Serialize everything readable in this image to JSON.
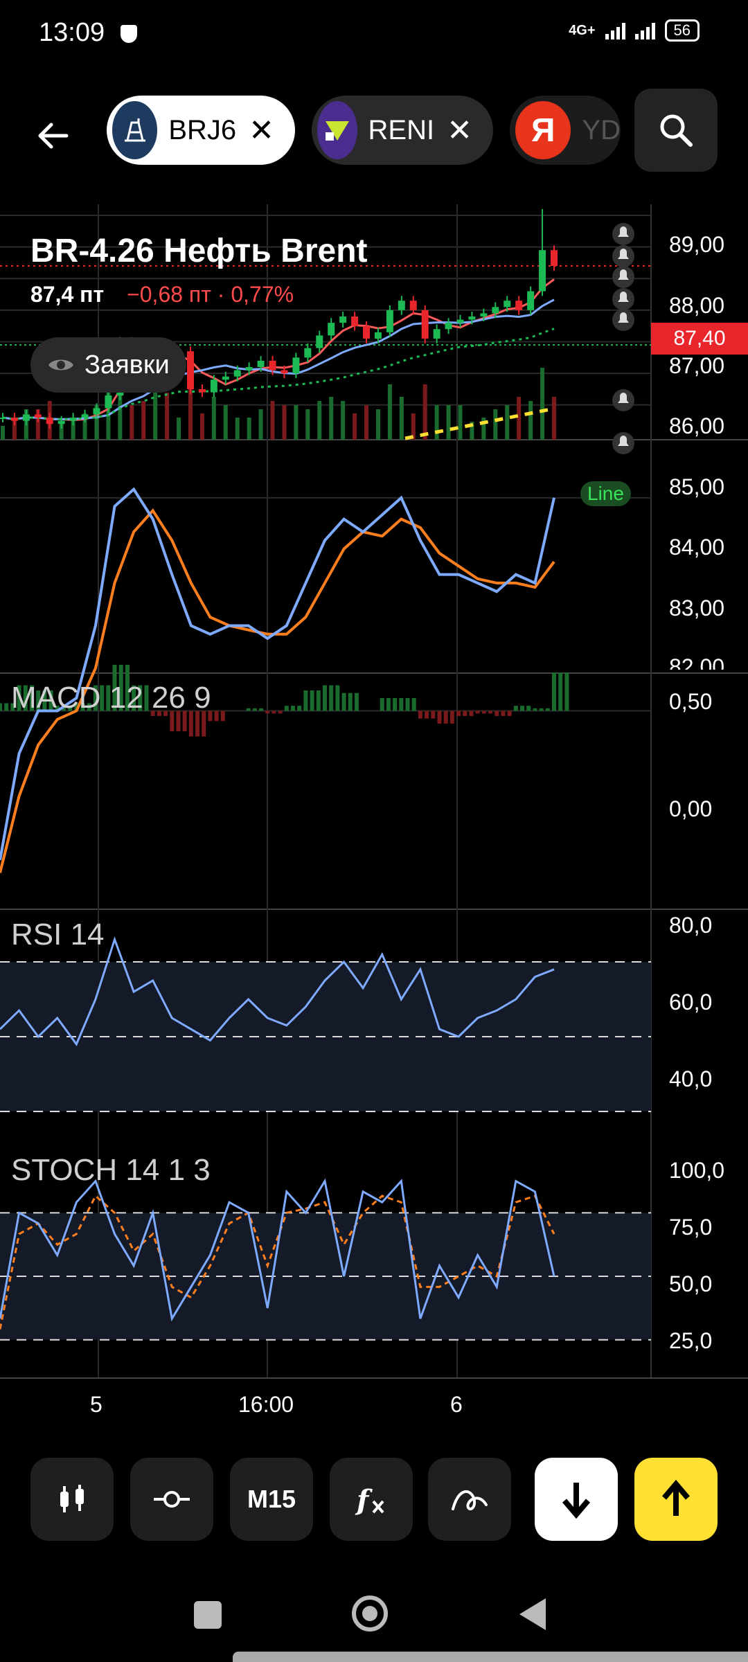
{
  "status": {
    "time": "13:09",
    "network": "4G+",
    "battery": "56"
  },
  "tabs": [
    {
      "label": "BRJ6",
      "close": "✕"
    },
    {
      "label": "RENI",
      "close": "✕"
    },
    {
      "label": "YD"
    }
  ],
  "instrument": {
    "title": "BR-4.26 Нефть Brent",
    "price": "87,4 пт",
    "change": "−0,68 пт · 0,77%",
    "orders_label": "Заявки",
    "current_price_tag": "87,40",
    "line_tag": "Line"
  },
  "price_axis": [
    "89,00",
    "88,00",
    "87,00",
    "86,00",
    "85,00",
    "84,00",
    "83,00",
    "82,00"
  ],
  "indicators": {
    "macd": {
      "label": "MACD 12 26 9",
      "axis": [
        "0,50",
        "0,00"
      ]
    },
    "rsi": {
      "label": "RSI 14",
      "axis": [
        "80,0",
        "60,0",
        "40,0"
      ]
    },
    "stoch": {
      "label": "STOCH 14 1 3",
      "axis": [
        "100,0",
        "75,0",
        "50,0",
        "25,0"
      ]
    }
  },
  "time_axis": [
    "5",
    "16:00",
    "6"
  ],
  "toolbar": {
    "interval": "M15"
  },
  "colors": {
    "up": "#1db954",
    "down": "#e8262b",
    "accent": "#ffe033",
    "ma_fast": "#ff5a5a",
    "ma_slow": "#7eaaff"
  },
  "chart_data": [
    {
      "type": "candlestick",
      "title": "BR-4.26 Нефть Brent",
      "ylim": [
        82,
        89.3
      ],
      "x": [
        "5",
        "16:00",
        "6"
      ],
      "close_series_approx": [
        82.6,
        82.5,
        82.7,
        82.6,
        82.4,
        82.5,
        82.6,
        82.7,
        82.9,
        83.3,
        85.0,
        84.6,
        84.2,
        84.9,
        84.5,
        84.7,
        83.5,
        83.4,
        83.8,
        83.9,
        84.1,
        84.2,
        84.4,
        84.1,
        84.0,
        84.5,
        84.8,
        85.2,
        85.6,
        85.8,
        85.5,
        85.1,
        85.3,
        86.0,
        86.3,
        86.0,
        85.1,
        85.4,
        85.6,
        85.7,
        85.8,
        85.9,
        86.1,
        86.3,
        86.0,
        86.6,
        87.9,
        87.4
      ]
    },
    {
      "type": "line",
      "title": "MACD 12 26 9",
      "ylim": [
        -0.4,
        0.6
      ],
      "series": [
        {
          "values": [
            -0.35,
            -0.1,
            0.0,
            0.0,
            0.03,
            0.2,
            0.48,
            0.52,
            0.45,
            0.32,
            0.2,
            0.18,
            0.2,
            0.2,
            0.17,
            0.2,
            0.3,
            0.4,
            0.45,
            0.42,
            0.46,
            0.5,
            0.4,
            0.32,
            0.32,
            0.3,
            0.28,
            0.32,
            0.3,
            0.5
          ]
        },
        {
          "values": [
            -0.38,
            -0.2,
            -0.08,
            -0.02,
            0.0,
            0.1,
            0.3,
            0.42,
            0.47,
            0.4,
            0.3,
            0.22,
            0.2,
            0.19,
            0.18,
            0.18,
            0.22,
            0.3,
            0.38,
            0.42,
            0.41,
            0.45,
            0.43,
            0.37,
            0.34,
            0.31,
            0.3,
            0.3,
            0.29,
            0.35
          ]
        }
      ]
    },
    {
      "type": "line",
      "title": "RSI 14",
      "ylim": [
        30,
        80
      ],
      "values": [
        52,
        57,
        50,
        55,
        48,
        60,
        76,
        62,
        65,
        55,
        52,
        49,
        55,
        60,
        55,
        53,
        58,
        65,
        70,
        63,
        72,
        60,
        68,
        52,
        50,
        55,
        57,
        60,
        66,
        68
      ]
    },
    {
      "type": "line",
      "title": "STOCH 14 1 3",
      "ylim": [
        15,
        105
      ],
      "series": [
        {
          "values": [
            30,
            80,
            75,
            60,
            85,
            95,
            70,
            55,
            80,
            30,
            45,
            60,
            85,
            80,
            35,
            90,
            80,
            95,
            50,
            90,
            85,
            95,
            30,
            55,
            40,
            60,
            45,
            95,
            90,
            50
          ]
        },
        {
          "values": [
            25,
            70,
            75,
            65,
            70,
            88,
            80,
            62,
            70,
            45,
            40,
            55,
            75,
            80,
            55,
            80,
            82,
            85,
            65,
            80,
            88,
            85,
            45,
            45,
            50,
            55,
            50,
            85,
            88,
            70
          ]
        }
      ]
    }
  ]
}
